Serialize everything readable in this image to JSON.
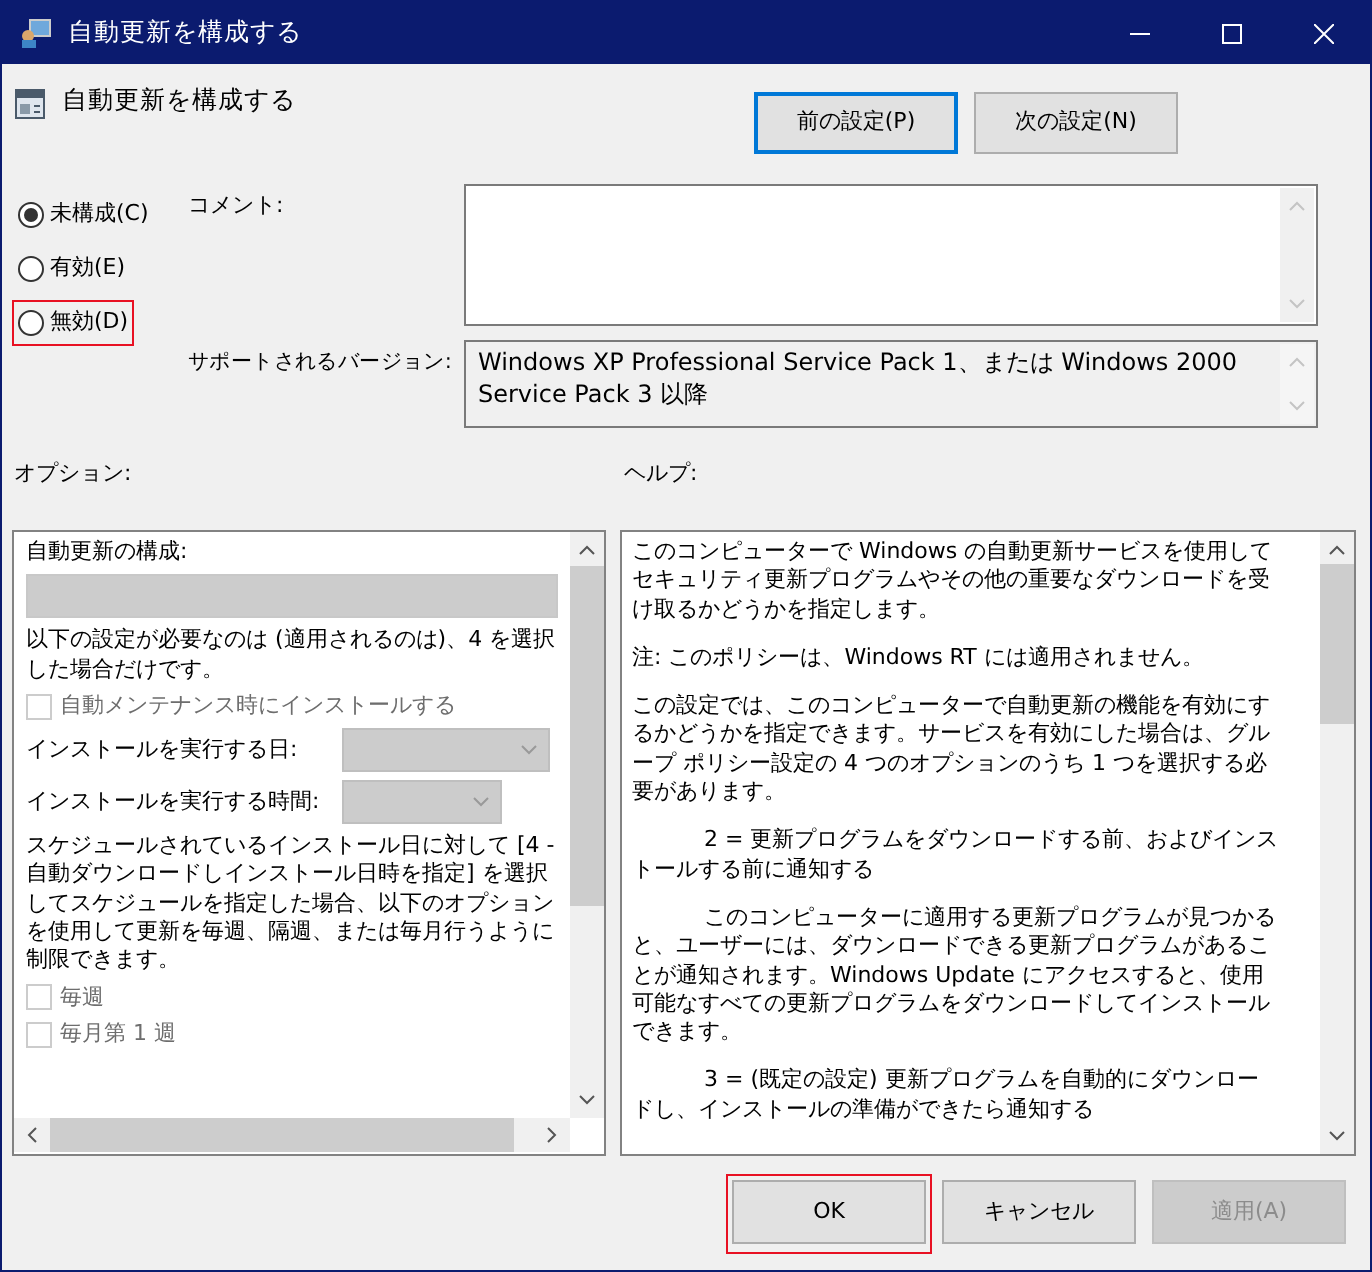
{
  "window": {
    "title": "自動更新を構成する"
  },
  "header": {
    "title": "自動更新を構成する",
    "buttons": [
      {
        "label": "前の設定(P)",
        "focused": true
      },
      {
        "label": "次の設定(N)",
        "focused": false
      }
    ]
  },
  "state_options": [
    {
      "label": "未構成(C)",
      "selected": true,
      "highlighted": false
    },
    {
      "label": "有効(E)",
      "selected": false,
      "highlighted": false
    },
    {
      "label": "無効(D)",
      "selected": false,
      "highlighted": true
    }
  ],
  "comment": {
    "label": "コメント:"
  },
  "supported": {
    "label": "サポートされるバージョン:",
    "value": "Windows XP Professional Service Pack 1、または Windows 2000 Service Pack 3 以降"
  },
  "options": {
    "label": "オプション:",
    "items": [
      {
        "kind": "heading",
        "text": "自動更新の構成:"
      },
      {
        "kind": "bar",
        "disabled": true
      },
      {
        "kind": "text",
        "text": "以下の設定が必要なのは (適用されるのは)、4 を選択した場合だけです。"
      },
      {
        "kind": "checkbox",
        "label": "自動メンテナンス時にインストールする",
        "checked": false,
        "disabled": true
      },
      {
        "kind": "combo",
        "label": "インストールを実行する日:",
        "disabled": true
      },
      {
        "kind": "combo",
        "label": "インストールを実行する時間:",
        "disabled": true
      },
      {
        "kind": "text",
        "text": "スケジュールされているインストール日に対して [4 - 自動ダウンロードしインストール日時を指定] を選択してスケジュールを指定した場合、以下のオプションを使用して更新を毎週、隔週、または毎月行うように制限できます。"
      },
      {
        "kind": "checkbox",
        "label": "毎週",
        "checked": false,
        "disabled": true
      },
      {
        "kind": "checkbox",
        "label": "毎月第 1 週",
        "checked": false,
        "disabled": true
      }
    ]
  },
  "help": {
    "label": "ヘルプ:",
    "paragraphs": [
      {
        "text": "このコンピューターで Windows の自動更新サービスを使用してセキュリティ更新プログラムやその他の重要なダウンロードを受け取るかどうかを指定します。",
        "indented": false
      },
      {
        "text": "注: このポリシーは、Windows RT には適用されません。",
        "indented": false
      },
      {
        "text": "この設定では、このコンピューターで自動更新の機能を有効にするかどうかを指定できます。サービスを有効にした場合は、グループ ポリシー設定の 4 つのオプションのうち 1 つを選択する必要があります。",
        "indented": false
      },
      {
        "text": "2 = 更新プログラムをダウンロードする前、およびインストールする前に通知する",
        "indented": true
      },
      {
        "text": "このコンピューターに適用する更新プログラムが見つかると、ユーザーには、ダウンロードできる更新プログラムがあることが通知されます。Windows Update にアクセスすると、使用可能なすべての更新プログラムをダウンロードしてインストールできます。",
        "indented": true
      },
      {
        "text": "3 = (既定の設定) 更新プログラムを自動的にダウンロードし、インストールの準備ができたら通知する",
        "indented": true
      }
    ]
  },
  "footer_buttons": [
    {
      "label": "OK",
      "disabled": false,
      "highlighted": true
    },
    {
      "label": "キャンセル",
      "disabled": false,
      "highlighted": false
    },
    {
      "label": "適用(A)",
      "disabled": true,
      "highlighted": false
    }
  ]
}
